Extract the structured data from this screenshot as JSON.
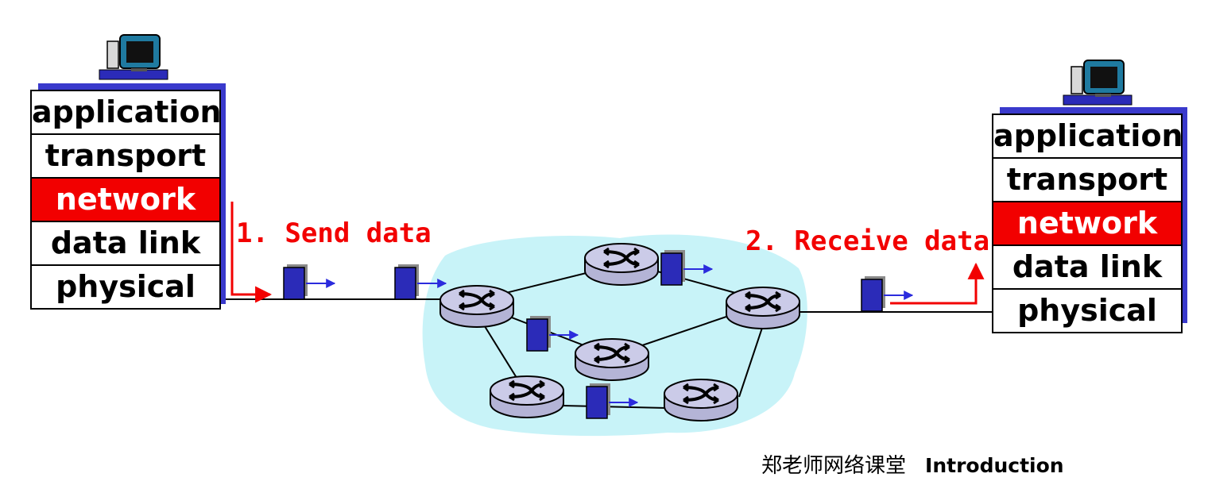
{
  "left_stack": {
    "layers": [
      "application",
      "transport",
      "network",
      "data link",
      "physical"
    ],
    "highlighted": "network"
  },
  "right_stack": {
    "layers": [
      "application",
      "transport",
      "network",
      "data link",
      "physical"
    ],
    "highlighted": "network"
  },
  "steps": {
    "send": "1. Send data",
    "receive": "2. Receive data"
  },
  "footer": {
    "course": "郑老师网络课堂",
    "section": "Introduction"
  },
  "colors": {
    "highlight": "#f20000",
    "stack_shadow": "#3a3acc",
    "packet": "#2b2bb8",
    "cloud": "#c8f3f8",
    "router": "#c8c8e6"
  },
  "icons": [
    "desktop-computer-icon",
    "router-icon",
    "packet-icon"
  ]
}
